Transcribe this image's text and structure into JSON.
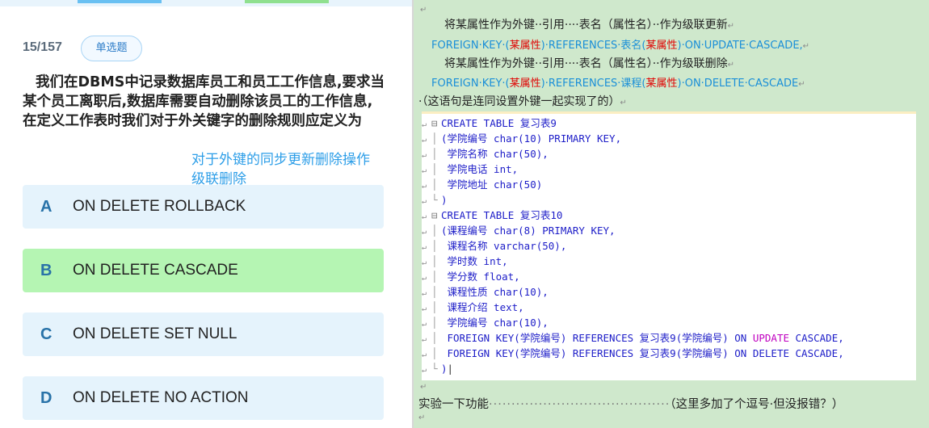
{
  "quiz": {
    "counter": "15/157",
    "type_badge": "单选题",
    "question": "我们在DBMS中记录数据库员工和员工工作信息,要求当某个员工离职后,数据库需要自动删除该员工的工作信息,在定义工作表时我们对于外关键字的删除规则应定义为",
    "annotation_line1": "对于外键的同步更新删除操作",
    "annotation_line2": "级联删除",
    "options": [
      {
        "letter": "A",
        "text": "ON DELETE ROLLBACK",
        "selected": false
      },
      {
        "letter": "B",
        "text": "ON DELETE CASCADE",
        "selected": true
      },
      {
        "letter": "C",
        "text": "ON DELETE SET NULL",
        "selected": false
      },
      {
        "letter": "D",
        "text": "ON DELETE NO ACTION",
        "selected": false
      }
    ]
  },
  "doc": {
    "note1": "将某属性作为外键··引用····表名（属性名）··作为级联更新",
    "sql1_a": "FOREIGN·KEY·(",
    "sql1_b": "某属性",
    "sql1_c": ")·REFERENCES·表名(",
    "sql1_d": "某属性",
    "sql1_e": ")·ON·UPDATE·CASCADE,",
    "note2": "将某属性作为外键··引用····表名（属性名）··作为级联删除",
    "sql2_a": "FOREIGN·KEY·(",
    "sql2_b": "某属性",
    "sql2_c": ")·REFERENCES·课程(",
    "sql2_d": "某属性",
    "sql2_e": ")·ON·DELETE·CASCADE",
    "note3": "·（这语句是连同设置外键一起实现了的）",
    "code": {
      "l1": "CREATE TABLE 复习表9",
      "l2": "(学院编号 char(10) PRIMARY KEY,",
      "l3": " 学院名称 char(50),",
      "l4": " 学院电话 int,",
      "l5": " 学院地址 char(50)",
      "l6": ")",
      "l7": "CREATE TABLE 复习表10",
      "l8": "(课程编号 char(8) PRIMARY KEY,",
      "l9": " 课程名称 varchar(50),",
      "l10": " 学时数 int,",
      "l11": " 学分数 float,",
      "l12": " 课程性质 char(10),",
      "l13": " 课程介绍 text,",
      "l14": " 学院编号 char(10),",
      "l15a": " FOREIGN KEY(学院编号) REFERENCES 复习表9(学院编号) ON ",
      "l15b": "UPDATE",
      "l15c": " CASCADE,",
      "l16": " FOREIGN KEY(学院编号) REFERENCES 复习表9(学院编号) ON DELETE CASCADE,",
      "l17": ")"
    },
    "footer_text": "实验一下功能",
    "footer_dots": "········································",
    "footer_note": "（这里多加了个逗号·但没报错？）"
  },
  "colors": {
    "accent_blue": "#2d9ee8",
    "selected_green": "#b5f5b3",
    "option_bg": "#e5f3fc",
    "doc_bg": "#cfe8cc",
    "sql_keyword": "#1d1dc8",
    "highlight_red": "#e00000",
    "update_magenta": "#c000c0"
  }
}
